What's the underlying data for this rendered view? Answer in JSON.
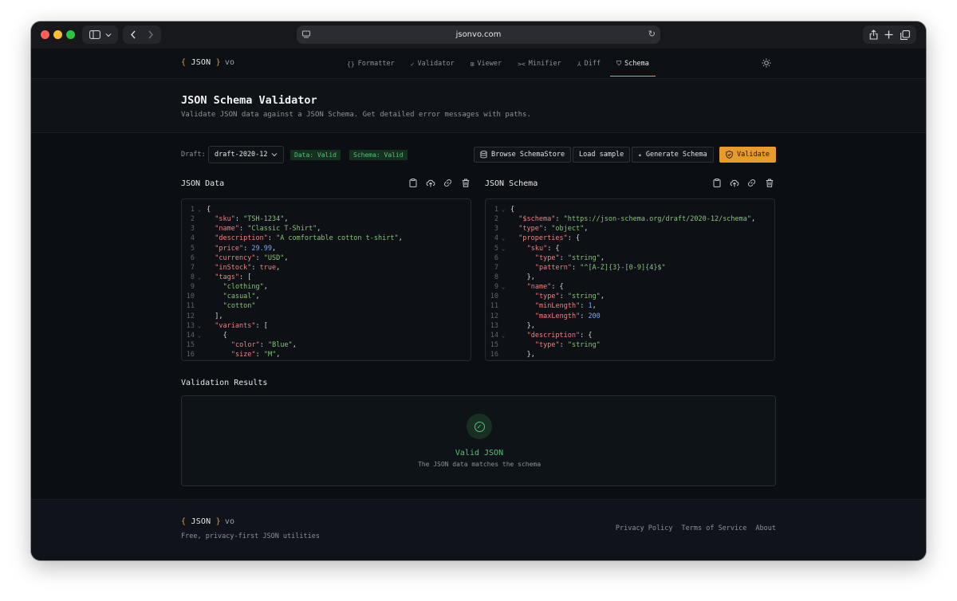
{
  "browser": {
    "url": "jsonvo.com",
    "sidebar_icon": "sidebar-icon",
    "back_icon": "chevron-left-icon",
    "forward_icon": "chevron-right-icon",
    "share_icon": "share-icon",
    "new_tab_icon": "plus-icon",
    "tabs_icon": "tabs-icon",
    "reload_icon": "reload-icon"
  },
  "brand": {
    "open": "{",
    "name": "JSON",
    "close": "}",
    "suffix": "vo"
  },
  "nav": {
    "items": [
      {
        "icon": "{}",
        "label": "Formatter"
      },
      {
        "icon": "✓",
        "label": "Validator"
      },
      {
        "icon": "⊞",
        "label": "Viewer"
      },
      {
        "icon": "><",
        "label": "Minifier"
      },
      {
        "icon": "⅄",
        "label": "Diff"
      },
      {
        "icon": "⛉",
        "label": "Schema"
      }
    ],
    "active": "Schema",
    "theme_icon": "sun-icon"
  },
  "hero": {
    "title": "JSON Schema Validator",
    "subtitle": "Validate JSON data against a JSON Schema. Get detailed error messages with paths."
  },
  "toolbar": {
    "draft_label": "Draft:",
    "draft_value": "draft-2020-12",
    "data_badge": "Data: Valid",
    "schema_badge": "Schema: Valid",
    "browse_label": "Browse SchemaStore",
    "load_sample_label": "Load sample",
    "generate_label": "Generate Schema",
    "validate_label": "Validate"
  },
  "data_panel": {
    "title": "JSON Data",
    "icons": [
      "clipboard-icon",
      "upload-icon",
      "link-icon",
      "trash-icon"
    ],
    "lines": [
      {
        "n": "1",
        "fold": true,
        "indent": 0,
        "tokens": [
          [
            "p",
            "{"
          ]
        ]
      },
      {
        "n": "2",
        "fold": false,
        "indent": 1,
        "tokens": [
          [
            "k",
            "\"sku\""
          ],
          [
            "p",
            ": "
          ],
          [
            "s",
            "\"TSH-1234\""
          ],
          [
            "p",
            ","
          ]
        ]
      },
      {
        "n": "3",
        "fold": false,
        "indent": 1,
        "tokens": [
          [
            "k",
            "\"name\""
          ],
          [
            "p",
            ": "
          ],
          [
            "s",
            "\"Classic T-Shirt\""
          ],
          [
            "p",
            ","
          ]
        ]
      },
      {
        "n": "4",
        "fold": false,
        "indent": 1,
        "tokens": [
          [
            "k",
            "\"description\""
          ],
          [
            "p",
            ": "
          ],
          [
            "s",
            "\"A comfortable cotton t-shirt\""
          ],
          [
            "p",
            ","
          ]
        ]
      },
      {
        "n": "5",
        "fold": false,
        "indent": 1,
        "tokens": [
          [
            "k",
            "\"price\""
          ],
          [
            "p",
            ": "
          ],
          [
            "n",
            "29.99"
          ],
          [
            "p",
            ","
          ]
        ]
      },
      {
        "n": "6",
        "fold": false,
        "indent": 1,
        "tokens": [
          [
            "k",
            "\"currency\""
          ],
          [
            "p",
            ": "
          ],
          [
            "s",
            "\"USD\""
          ],
          [
            "p",
            ","
          ]
        ]
      },
      {
        "n": "7",
        "fold": false,
        "indent": 1,
        "tokens": [
          [
            "k",
            "\"inStock\""
          ],
          [
            "p",
            ": "
          ],
          [
            "b",
            "true"
          ],
          [
            "p",
            ","
          ]
        ]
      },
      {
        "n": "8",
        "fold": true,
        "indent": 1,
        "tokens": [
          [
            "k",
            "\"tags\""
          ],
          [
            "p",
            ": ["
          ]
        ]
      },
      {
        "n": "9",
        "fold": false,
        "indent": 2,
        "tokens": [
          [
            "s",
            "\"clothing\""
          ],
          [
            "p",
            ","
          ]
        ]
      },
      {
        "n": "10",
        "fold": false,
        "indent": 2,
        "tokens": [
          [
            "s",
            "\"casual\""
          ],
          [
            "p",
            ","
          ]
        ]
      },
      {
        "n": "11",
        "fold": false,
        "indent": 2,
        "tokens": [
          [
            "s",
            "\"cotton\""
          ]
        ]
      },
      {
        "n": "12",
        "fold": false,
        "indent": 1,
        "tokens": [
          [
            "p",
            "],"
          ]
        ]
      },
      {
        "n": "13",
        "fold": true,
        "indent": 1,
        "tokens": [
          [
            "k",
            "\"variants\""
          ],
          [
            "p",
            ": ["
          ]
        ]
      },
      {
        "n": "14",
        "fold": true,
        "indent": 2,
        "tokens": [
          [
            "p",
            "{"
          ]
        ]
      },
      {
        "n": "15",
        "fold": false,
        "indent": 3,
        "tokens": [
          [
            "k",
            "\"color\""
          ],
          [
            "p",
            ": "
          ],
          [
            "s",
            "\"Blue\""
          ],
          [
            "p",
            ","
          ]
        ]
      },
      {
        "n": "16",
        "fold": false,
        "indent": 3,
        "tokens": [
          [
            "k",
            "\"size\""
          ],
          [
            "p",
            ": "
          ],
          [
            "s",
            "\"M\""
          ],
          [
            "p",
            ","
          ]
        ]
      }
    ]
  },
  "schema_panel": {
    "title": "JSON Schema",
    "icons": [
      "clipboard-icon",
      "upload-icon",
      "link-icon",
      "trash-icon"
    ],
    "lines": [
      {
        "n": "1",
        "fold": true,
        "indent": 0,
        "tokens": [
          [
            "p",
            "{"
          ]
        ]
      },
      {
        "n": "2",
        "fold": false,
        "indent": 1,
        "tokens": [
          [
            "k",
            "\"$schema\""
          ],
          [
            "p",
            ": "
          ],
          [
            "s",
            "\"https://json-schema.org/draft/2020-12/schema\""
          ],
          [
            "p",
            ","
          ]
        ]
      },
      {
        "n": "3",
        "fold": false,
        "indent": 1,
        "tokens": [
          [
            "k",
            "\"type\""
          ],
          [
            "p",
            ": "
          ],
          [
            "s",
            "\"object\""
          ],
          [
            "p",
            ","
          ]
        ]
      },
      {
        "n": "4",
        "fold": true,
        "indent": 1,
        "tokens": [
          [
            "k",
            "\"properties\""
          ],
          [
            "p",
            ": {"
          ]
        ]
      },
      {
        "n": "5",
        "fold": true,
        "indent": 2,
        "tokens": [
          [
            "k",
            "\"sku\""
          ],
          [
            "p",
            ": {"
          ]
        ]
      },
      {
        "n": "6",
        "fold": false,
        "indent": 3,
        "tokens": [
          [
            "k",
            "\"type\""
          ],
          [
            "p",
            ": "
          ],
          [
            "s",
            "\"string\""
          ],
          [
            "p",
            ","
          ]
        ]
      },
      {
        "n": "7",
        "fold": false,
        "indent": 3,
        "tokens": [
          [
            "k",
            "\"pattern\""
          ],
          [
            "p",
            ": "
          ],
          [
            "s",
            "\"^[A-Z]{3}-[0-9]{4}$\""
          ]
        ]
      },
      {
        "n": "8",
        "fold": false,
        "indent": 2,
        "tokens": [
          [
            "p",
            "},"
          ]
        ]
      },
      {
        "n": "9",
        "fold": true,
        "indent": 2,
        "tokens": [
          [
            "k",
            "\"name\""
          ],
          [
            "p",
            ": {"
          ]
        ]
      },
      {
        "n": "10",
        "fold": false,
        "indent": 3,
        "tokens": [
          [
            "k",
            "\"type\""
          ],
          [
            "p",
            ": "
          ],
          [
            "s",
            "\"string\""
          ],
          [
            "p",
            ","
          ]
        ]
      },
      {
        "n": "11",
        "fold": false,
        "indent": 3,
        "tokens": [
          [
            "k",
            "\"minLength\""
          ],
          [
            "p",
            ": "
          ],
          [
            "n",
            "1"
          ],
          [
            "p",
            ","
          ]
        ]
      },
      {
        "n": "12",
        "fold": false,
        "indent": 3,
        "tokens": [
          [
            "k",
            "\"maxLength\""
          ],
          [
            "p",
            ": "
          ],
          [
            "n",
            "200"
          ]
        ]
      },
      {
        "n": "13",
        "fold": false,
        "indent": 2,
        "tokens": [
          [
            "p",
            "},"
          ]
        ]
      },
      {
        "n": "14",
        "fold": true,
        "indent": 2,
        "tokens": [
          [
            "k",
            "\"description\""
          ],
          [
            "p",
            ": {"
          ]
        ]
      },
      {
        "n": "15",
        "fold": false,
        "indent": 3,
        "tokens": [
          [
            "k",
            "\"type\""
          ],
          [
            "p",
            ": "
          ],
          [
            "s",
            "\"string\""
          ]
        ]
      },
      {
        "n": "16",
        "fold": false,
        "indent": 2,
        "tokens": [
          [
            "p",
            "},"
          ]
        ]
      }
    ]
  },
  "results": {
    "title": "Validation Results",
    "status_title": "Valid JSON",
    "status_message": "The JSON data matches the schema",
    "status_icon": "check-circle-icon"
  },
  "footer": {
    "tagline": "Free, privacy-first JSON utilities",
    "links": [
      "Privacy Policy",
      "Terms of Service",
      "About"
    ]
  },
  "colors": {
    "accent": "#e89a2a",
    "valid": "#58c07a",
    "background": "#0b0e13",
    "json_key": "#e98384",
    "json_string": "#87c27d",
    "json_number": "#7da7f0"
  }
}
